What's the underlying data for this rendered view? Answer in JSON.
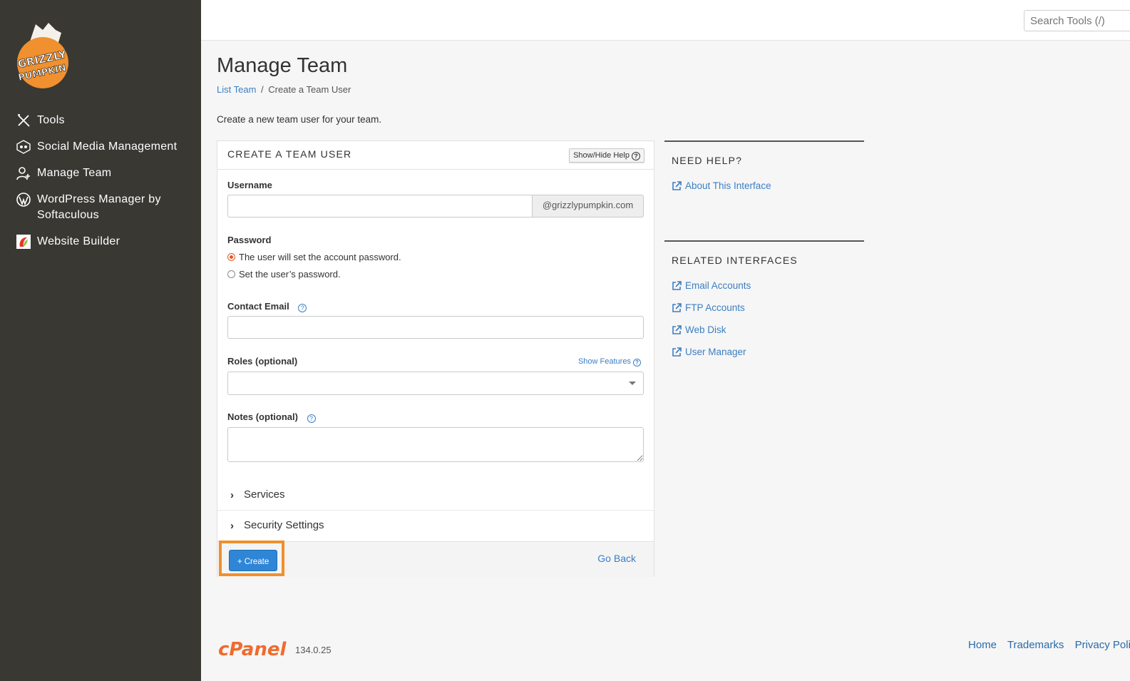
{
  "sidebar": {
    "logo": {
      "line1": "GRIZZLY",
      "line2": "PUMPKIN"
    },
    "items": [
      {
        "label": "Tools",
        "icon": "tools-icon"
      },
      {
        "label": "Social Media Management",
        "icon": "social-media-icon"
      },
      {
        "label": "Manage Team",
        "icon": "team-icon"
      },
      {
        "label": "WordPress Manager by Softaculous",
        "icon": "wordpress-icon"
      },
      {
        "label": "Website Builder",
        "icon": "website-builder-icon"
      }
    ]
  },
  "header": {
    "search_placeholder": "Search Tools (/)"
  },
  "page": {
    "title": "Manage Team",
    "breadcrumb": {
      "link": "List Team",
      "separator": "/",
      "current": "Create a Team User"
    },
    "intro": "Create a new team user for your team."
  },
  "form": {
    "title": "CREATE A TEAM USER",
    "help_toggle": "Show/Hide Help",
    "username_label": "Username",
    "username_value": "",
    "domain_suffix": "@grizzlypumpkin.com",
    "password_label": "Password",
    "password_options": [
      "The user will set the account password.",
      "Set the user’s password."
    ],
    "password_selected": 0,
    "contact_email_label": "Contact Email",
    "contact_email_value": "",
    "roles_label": "Roles (optional)",
    "show_features": "Show Features",
    "roles_value": "",
    "notes_label": "Notes (optional)",
    "notes_value": "",
    "sections": [
      "Services",
      "Security Settings"
    ],
    "create_label": "Create",
    "go_back_label": "Go Back"
  },
  "help_panel": {
    "need_help_title": "NEED HELP?",
    "need_help_links": [
      "About This Interface"
    ],
    "related_title": "RELATED INTERFACES",
    "related_links": [
      "Email Accounts",
      "FTP Accounts",
      "Web Disk",
      "User Manager"
    ]
  },
  "footer": {
    "brand": "cPanel",
    "version": "134.0.25",
    "links": [
      "Home",
      "Trademarks",
      "Privacy Policy"
    ]
  },
  "colors": {
    "sidebar_bg": "#3a3833",
    "accent_orange": "#f0902e",
    "link_blue": "#3b7fc4",
    "button_blue": "#2f86d6"
  }
}
